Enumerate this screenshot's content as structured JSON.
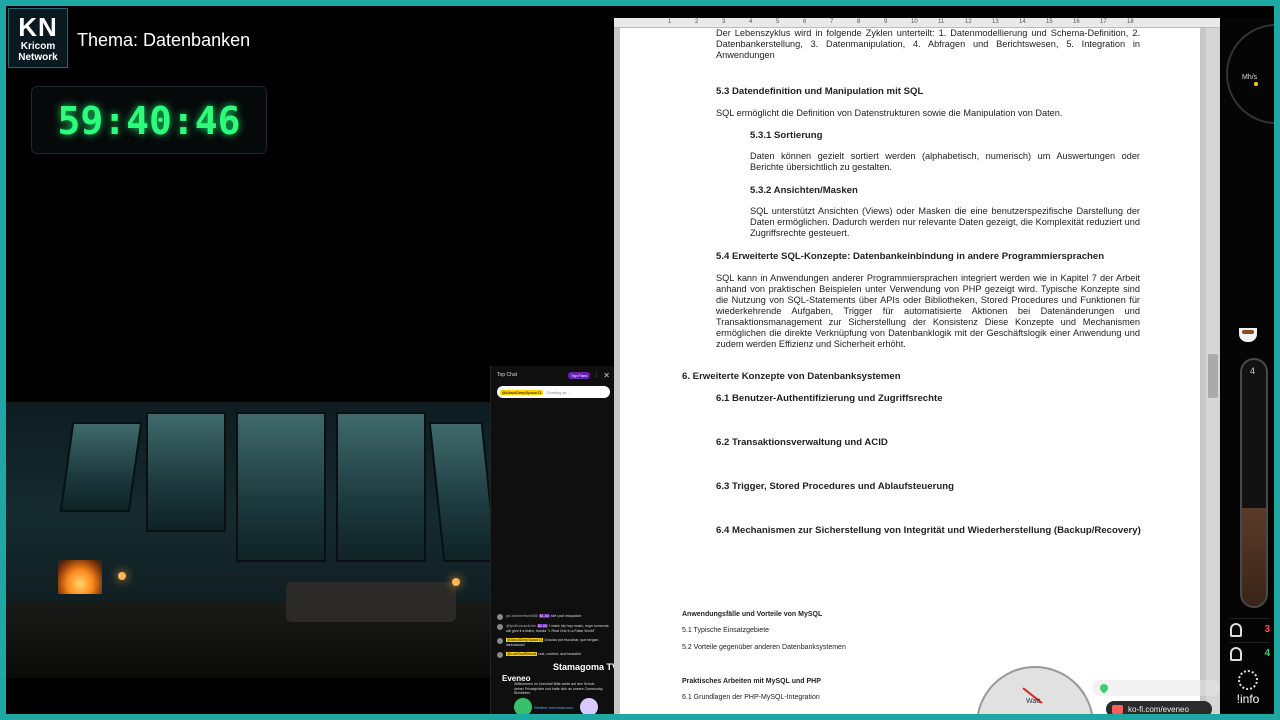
{
  "logo": {
    "short": "KN",
    "line1": "Kricom",
    "line2": "Network"
  },
  "topic": "Thema: Datenbanken",
  "timer": "59:40:46",
  "chat": {
    "title": "Top Chat",
    "top_fans": "Top Fans",
    "input_tag": "@AbsolDeepSpace13",
    "input_placeholder": "Chatting as ...",
    "messages": [
      {
        "name": "gio.sambertfan9586",
        "badge": "$1.00",
        "text": "sitë çoal relaçación"
      },
      {
        "name": "@lipidfromaudiobe",
        "badge": "$2.00",
        "text": "I make hip hop music, hope someone will give it a listen, thanks \"L Real One in a False World\""
      },
      {
        "name": "@AbsolDeepSpace13",
        "highlight": true,
        "text": "Gracias por escuchar, que tengan disfrutando!"
      },
      {
        "name": "@LostSoulRetreat",
        "highlight": true,
        "text": "rest, comfort, and beautiful"
      }
    ],
    "user1": "Stamagoma TV",
    "user2": "Eveneo",
    "welcome": "Willkommen im Livechat! Bitte achte auf den Schutz deiner Privatsphäre und halte dich an unsere Community-Richtlinien.",
    "link": "Weitere Informationen"
  },
  "ruler_numbers": [
    "1",
    "2",
    "3",
    "4",
    "5",
    "6",
    "7",
    "8",
    "9",
    "10",
    "11",
    "12",
    "13",
    "14",
    "15",
    "16",
    "17",
    "18"
  ],
  "document": {
    "intro": "Der Lebenszyklus wird in folgende Zyklen unterteilt: 1. Datenmodellierung und Schema-Definition, 2. Datenbankerstellung, 3. Datenmanipulation, 4. Abfragen und Berichtswesen, 5. Integration in Anwendungen",
    "h53": "5.3 Datendefinition und Manipulation mit SQL",
    "p53": "SQL ermöglicht die Definition von Datenstrukturen sowie die Manipulation von Daten.",
    "h531": "5.3.1 Sortierung",
    "p531": "Daten können gezielt sortiert werden (alphabetisch, numerisch) um Auswertungen oder Berichte übersichtlich zu gestalten.",
    "h532": "5.3.2 Ansichten/Masken",
    "p532": "SQL unterstützt Ansichten (Views) oder Masken die eine benutzerspezifische Darstellung der Daten ermöglichen. Dadurch werden nur relevante Daten gezeigt, die Komplexität reduziert und Zugriffsrechte gesteuert.",
    "h54": "5.4 Erweiterte SQL-Konzepte: Datenbankeinbindung in andere Programmiersprachen",
    "p54": "SQL kann in Anwendungen anderer Programmiersprachen integriert werden wie in Kapitel 7 der Arbeit anhand von praktischen Beispielen unter Verwendung von PHP gezeigt wird. Typische Konzepte sind die Nutzung von SQL-Statements über APIs oder Bibliotheken, Stored Procedures und Funktionen für wiederkehrende Aufgaben, Trigger für automatisierte Aktionen bei Datenänderungen und Transaktionsmanagement zur Sicherstellung der Konsistenz Diese Konzepte und Mechanismen ermöglichen die direkte Verknüpfung von Datenbanklogik mit der Geschäftslogik einer Anwendung und zudem werden Effizienz und Sicherheit erhöht.",
    "h6": "6. Erweiterte Konzepte von Datenbanksystemen",
    "h61": "6.1 Benutzer-Authentifizierung und Zugriffsrechte",
    "h62": "6.2 Transaktionsverwaltung und ACID",
    "h63": "6.3 Trigger, Stored Procedures und Ablaufsteuerung",
    "h64": "6.4 Mechanismen zur Sicherstellung von Integrität und Wiederherstellung (Backup/Recovery)",
    "n1": "Anwendungsfälle und Vorteile von MySQL",
    "n2": "5.1 Typische Einsatzgebiete",
    "n3": "5.2 Vorteile gegenüber anderen Datenbanksystemen",
    "n4": "Praktisches Arbeiten mit MySQL und PHP",
    "n5": "6.1 Grundlagen der PHP-MySQL-Integration"
  },
  "right_panel": {
    "gauge_label": "Mh/s",
    "tube_value": "4",
    "counter1": "3",
    "counter1_color": "#ff4d4d",
    "counter2": "4",
    "counter2_color": "#3bd16f",
    "info": "!info"
  },
  "watt_label": "Watt",
  "kofi": "ko-fi.com/eveneo",
  "colors": {
    "accent": "#1fa7a3",
    "timer": "#2dff7d"
  }
}
